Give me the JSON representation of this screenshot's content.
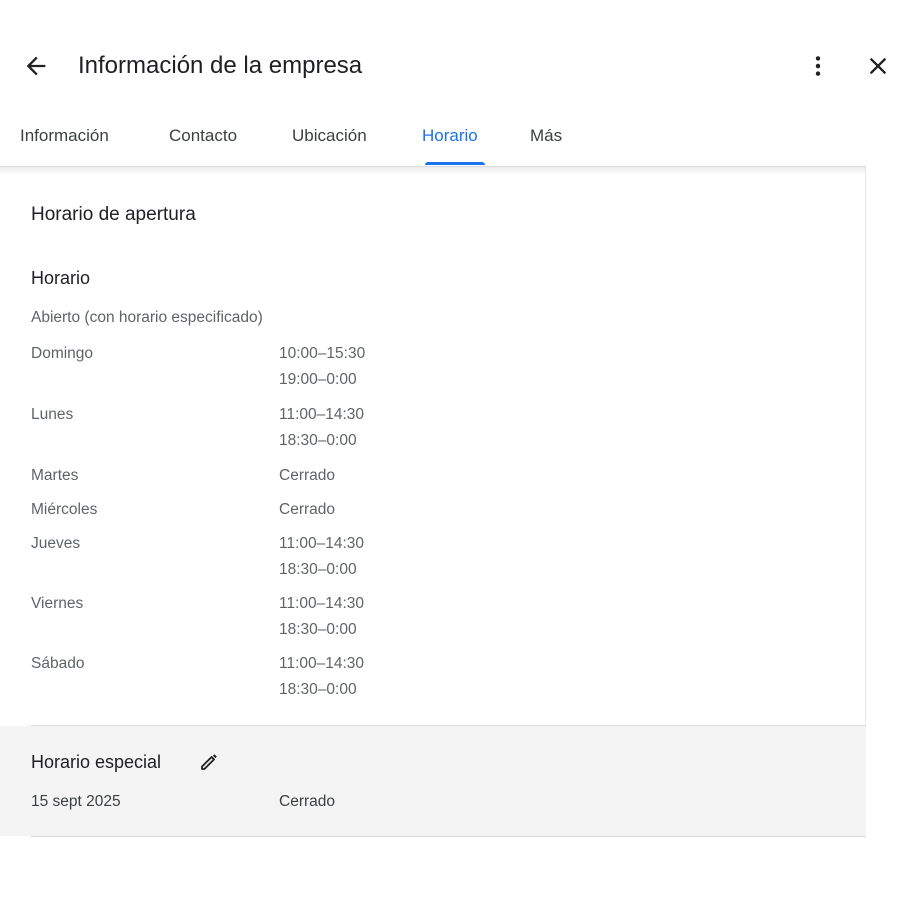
{
  "header": {
    "title": "Información de la empresa",
    "back_icon": "arrow-left-icon",
    "more_icon": "more-vert-icon",
    "close_icon": "close-icon"
  },
  "tabs": [
    {
      "label": "Información",
      "active": false
    },
    {
      "label": "Contacto",
      "active": false
    },
    {
      "label": "Ubicación",
      "active": false
    },
    {
      "label": "Horario",
      "active": true
    },
    {
      "label": "Más",
      "active": false
    }
  ],
  "hours": {
    "section_title": "Horario de apertura",
    "subtitle": "Horario",
    "status": "Abierto (con horario especificado)",
    "days": [
      {
        "day": "Domingo",
        "slots": [
          "10:00–15:30",
          "19:00–0:00"
        ]
      },
      {
        "day": "Lunes",
        "slots": [
          "11:00–14:30",
          "18:30–0:00"
        ]
      },
      {
        "day": "Martes",
        "slots": [
          "Cerrado"
        ]
      },
      {
        "day": "Miércoles",
        "slots": [
          "Cerrado"
        ]
      },
      {
        "day": "Jueves",
        "slots": [
          "11:00–14:30",
          "18:30–0:00"
        ]
      },
      {
        "day": "Viernes",
        "slots": [
          "11:00–14:30",
          "18:30–0:00"
        ]
      },
      {
        "day": "Sábado",
        "slots": [
          "11:00–14:30",
          "18:30–0:00"
        ]
      }
    ]
  },
  "special_hours": {
    "title": "Horario especial",
    "edit_icon": "pencil-icon",
    "entries": [
      {
        "date": "15 sept 2025",
        "status": "Cerrado"
      }
    ]
  },
  "colors": {
    "accent": "#1a73e8",
    "text_primary": "#202124",
    "text_secondary": "#5f6368",
    "special_bg": "#f4f4f4"
  }
}
